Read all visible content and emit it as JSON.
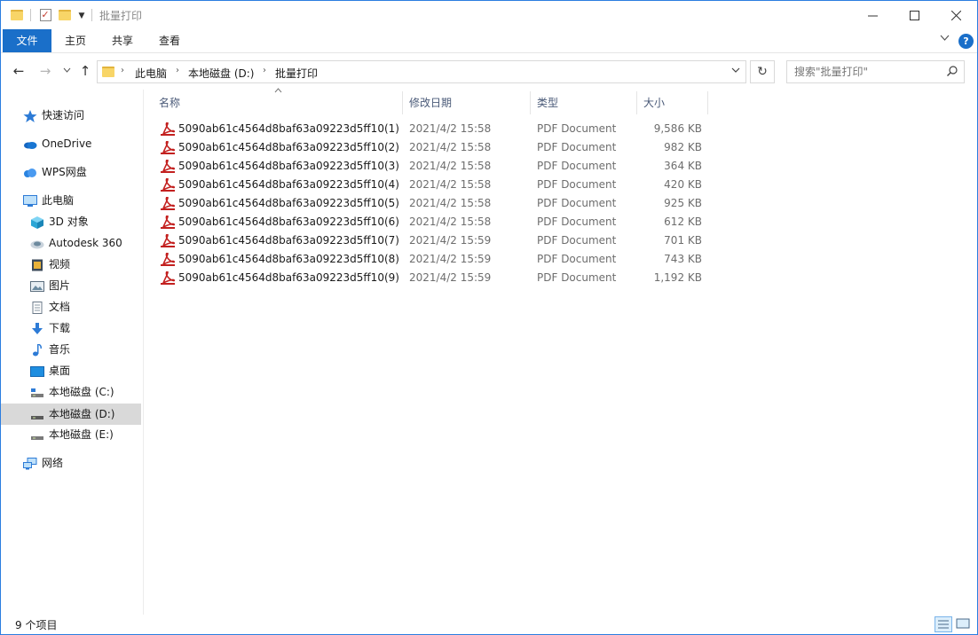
{
  "window": {
    "title": "批量打印"
  },
  "ribbon": {
    "tabs": [
      {
        "label": "文件",
        "active": true
      },
      {
        "label": "主页",
        "active": false
      },
      {
        "label": "共享",
        "active": false
      },
      {
        "label": "查看",
        "active": false
      }
    ],
    "help_label": "?"
  },
  "nav": {
    "breadcrumb": [
      "此电脑",
      "本地磁盘 (D:)",
      "批量打印"
    ],
    "search_placeholder": "搜索\"批量打印\""
  },
  "sidebar": {
    "items": [
      {
        "label": "快速访问",
        "icon": "star-icon",
        "level": 0
      },
      {
        "label": "OneDrive",
        "icon": "cloud-icon",
        "level": 0
      },
      {
        "label": "WPS网盘",
        "icon": "wps-cloud-icon",
        "level": 0
      },
      {
        "label": "此电脑",
        "icon": "computer-icon",
        "level": 0
      },
      {
        "label": "3D 对象",
        "icon": "cube-icon",
        "level": 1
      },
      {
        "label": "Autodesk 360",
        "icon": "autodesk-icon",
        "level": 1
      },
      {
        "label": "视频",
        "icon": "video-icon",
        "level": 1
      },
      {
        "label": "图片",
        "icon": "picture-icon",
        "level": 1
      },
      {
        "label": "文档",
        "icon": "document-icon",
        "level": 1
      },
      {
        "label": "下载",
        "icon": "download-icon",
        "level": 1
      },
      {
        "label": "音乐",
        "icon": "music-icon",
        "level": 1
      },
      {
        "label": "桌面",
        "icon": "desktop-icon",
        "level": 1
      },
      {
        "label": "本地磁盘 (C:)",
        "icon": "drive-icon",
        "level": 1
      },
      {
        "label": "本地磁盘 (D:)",
        "icon": "drive-icon",
        "level": 1,
        "selected": true
      },
      {
        "label": "本地磁盘 (E:)",
        "icon": "drive-icon",
        "level": 1
      },
      {
        "label": "网络",
        "icon": "network-icon",
        "level": 0
      }
    ]
  },
  "columns": {
    "name": "名称",
    "date": "修改日期",
    "type": "类型",
    "size": "大小"
  },
  "files": [
    {
      "name": "5090ab61c4564d8baf63a09223d5ff10(1)",
      "date": "2021/4/2 15:58",
      "type": "PDF Document",
      "size": "9,586 KB"
    },
    {
      "name": "5090ab61c4564d8baf63a09223d5ff10(2)",
      "date": "2021/4/2 15:58",
      "type": "PDF Document",
      "size": "982 KB"
    },
    {
      "name": "5090ab61c4564d8baf63a09223d5ff10(3)",
      "date": "2021/4/2 15:58",
      "type": "PDF Document",
      "size": "364 KB"
    },
    {
      "name": "5090ab61c4564d8baf63a09223d5ff10(4)",
      "date": "2021/4/2 15:58",
      "type": "PDF Document",
      "size": "420 KB"
    },
    {
      "name": "5090ab61c4564d8baf63a09223d5ff10(5)",
      "date": "2021/4/2 15:58",
      "type": "PDF Document",
      "size": "925 KB"
    },
    {
      "name": "5090ab61c4564d8baf63a09223d5ff10(6)",
      "date": "2021/4/2 15:58",
      "type": "PDF Document",
      "size": "612 KB"
    },
    {
      "name": "5090ab61c4564d8baf63a09223d5ff10(7)",
      "date": "2021/4/2 15:59",
      "type": "PDF Document",
      "size": "701 KB"
    },
    {
      "name": "5090ab61c4564d8baf63a09223d5ff10(8)",
      "date": "2021/4/2 15:59",
      "type": "PDF Document",
      "size": "743 KB"
    },
    {
      "name": "5090ab61c4564d8baf63a09223d5ff10(9)",
      "date": "2021/4/2 15:59",
      "type": "PDF Document",
      "size": "1,192 KB"
    }
  ],
  "status": {
    "item_count": "9 个项目"
  },
  "colors": {
    "accent": "#1a6fc9",
    "pdf_red": "#c3201f",
    "folder": "#f8d567"
  }
}
